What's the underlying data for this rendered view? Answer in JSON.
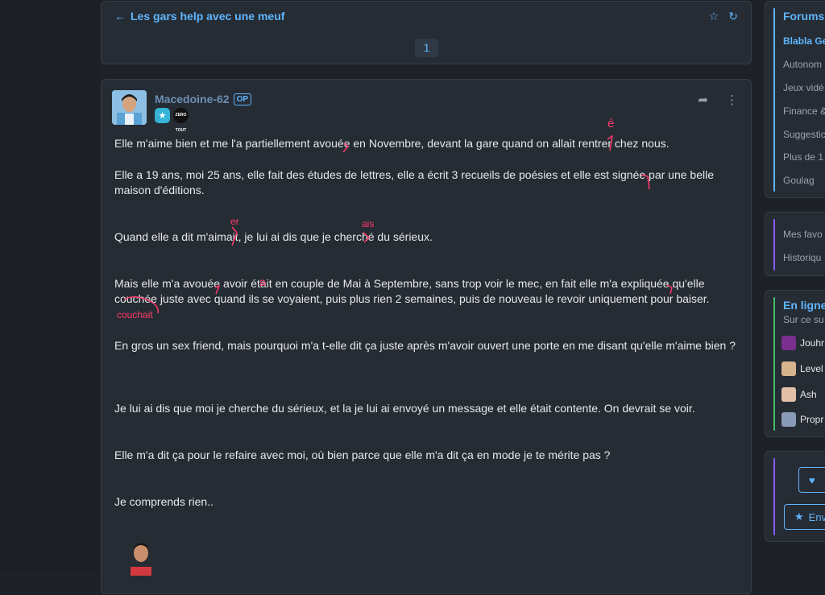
{
  "topic": {
    "title": "Les gars help avec une meuf",
    "page_number": "1"
  },
  "post": {
    "author": "Macedoine-62",
    "op_badge": "OP",
    "badge_text": "ZERO TOUT",
    "paragraphs": [
      "Elle m'aime bien et me l'a partiellement avouée en Novembre, devant la gare quand on allait rentrer chez nous.",
      "Elle a 19 ans, moi 25 ans, elle fait des études de lettres, elle a écrit 3 recueils de poésies et elle est signée par une belle maison d'éditions.",
      "Quand elle a dit m'aimait, je lui ai dis que je cherché du sérieux.",
      "Mais elle m'a avouée avoir était en couple de Mai à Septembre, sans trop voir le mec, en fait elle m'a expliquée qu'elle couchée juste avec quand ils se voyaient, puis plus rien 2 semaines, puis de nouveau le revoir uniquement pour baiser.",
      "En gros un sex friend, mais pourquoi m'a t-elle dit ça juste après m'avoir ouvert une porte en me disant qu'elle m'aime bien ?",
      "Je lui ai dis que moi je cherche du sérieux, et la je lui ai envoyé un message et elle était contente. On devrait se voir.",
      "Elle m'a dit ça pour le refaire avec moi, où bien parce que elle m'a dit ça en mode je te mérite pas ?",
      "Je comprends rien.."
    ],
    "annotations": {
      "e_accent": "é",
      "er": "er",
      "ais": "ais",
      "a": "a",
      "couchait": "couchait"
    }
  },
  "sidebar": {
    "forums_title": "Forums",
    "forums": [
      "Blabla Ge",
      "Autonom",
      "Jeux vidé",
      "Finance &",
      "Suggestic",
      "Plus de 1",
      "Goulag"
    ],
    "links": [
      "Mes favo",
      "Historiqu"
    ],
    "online_title": "En ligne",
    "online_subtitle": "Sur ce su",
    "online_users": [
      "Jouhr",
      "Level",
      "Ash",
      "Propr"
    ],
    "btn_fav": "",
    "btn_follow": "Env"
  },
  "colors": {
    "accent": "#5fb6ff",
    "annotation": "#ff3a6b",
    "card_bg": "#262c34"
  }
}
